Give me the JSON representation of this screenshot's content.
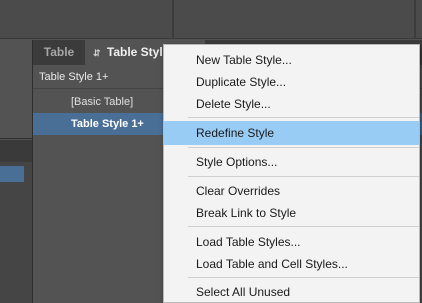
{
  "panel": {
    "tabs": [
      {
        "label": "Table"
      },
      {
        "label": "Table Styles"
      }
    ],
    "current_style": "Table Style 1+",
    "styles": [
      {
        "label": "[Basic Table]"
      },
      {
        "label": "Table Style 1+"
      }
    ],
    "icons": {
      "tab_updown": "up-down-arrows-icon",
      "panel_menu": "panel-menu-icon",
      "redefine": "lightning-icon"
    }
  },
  "menu": {
    "items": [
      {
        "label": "New Table Style..."
      },
      {
        "label": "Duplicate Style..."
      },
      {
        "label": "Delete Style..."
      },
      {
        "label": "Redefine Style",
        "highlighted": true
      },
      {
        "label": "Style Options..."
      },
      {
        "label": "Clear Overrides"
      },
      {
        "label": "Break Link to Style"
      },
      {
        "label": "Load Table Styles..."
      },
      {
        "label": "Load Table and Cell Styles..."
      },
      {
        "label": "Select All Unused"
      }
    ]
  },
  "colors": {
    "selection": "#4a6f96",
    "menu_highlight": "#99ccf5",
    "menu_background": "#f3f3f3",
    "panel_background": "#535353"
  }
}
